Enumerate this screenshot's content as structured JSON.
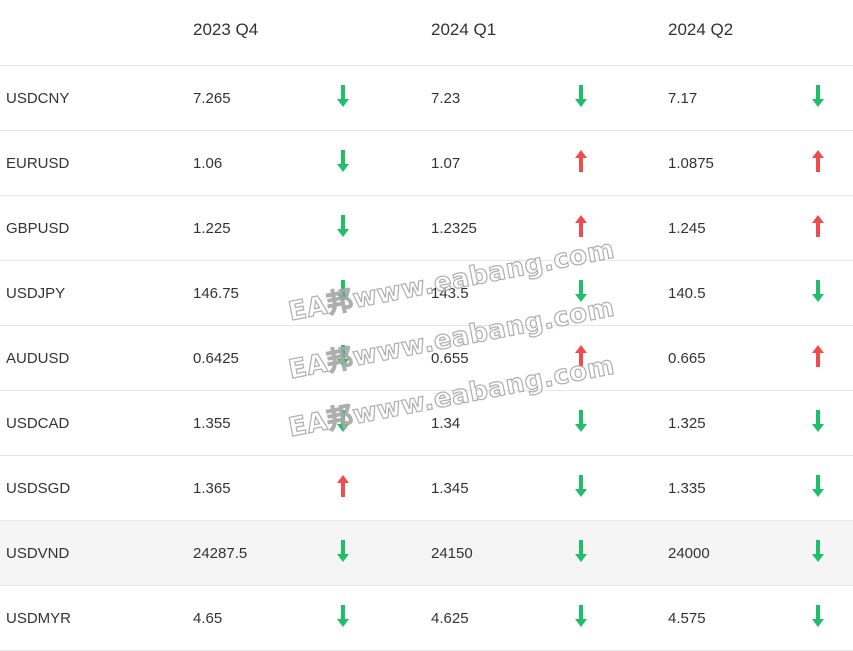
{
  "header": {
    "col1": "2023 Q4",
    "col2": "2024 Q1",
    "col3": "2024 Q2"
  },
  "colors": {
    "down": "#1fbf6a",
    "up": "#ef4d4d"
  },
  "rows": [
    {
      "pair": "USDCNY",
      "v1": "7.265",
      "d1": "down",
      "v2": "7.23",
      "d2": "down",
      "v3": "7.17",
      "d3": "down"
    },
    {
      "pair": "EURUSD",
      "v1": "1.06",
      "d1": "down",
      "v2": "1.07",
      "d2": "up",
      "v3": "1.0875",
      "d3": "up"
    },
    {
      "pair": "GBPUSD",
      "v1": "1.225",
      "d1": "down",
      "v2": "1.2325",
      "d2": "up",
      "v3": "1.245",
      "d3": "up"
    },
    {
      "pair": "USDJPY",
      "v1": "146.75",
      "d1": "down",
      "v2": "143.5",
      "d2": "down",
      "v3": "140.5",
      "d3": "down"
    },
    {
      "pair": "AUDUSD",
      "v1": "0.6425",
      "d1": "down",
      "v2": "0.655",
      "d2": "up",
      "v3": "0.665",
      "d3": "up"
    },
    {
      "pair": "USDCAD",
      "v1": "1.355",
      "d1": "down",
      "v2": "1.34",
      "d2": "down",
      "v3": "1.325",
      "d3": "down"
    },
    {
      "pair": "USDSGD",
      "v1": "1.365",
      "d1": "up",
      "v2": "1.345",
      "d2": "down",
      "v3": "1.335",
      "d3": "down"
    },
    {
      "pair": "USDVND",
      "v1": "24287.5",
      "d1": "down",
      "v2": "24150",
      "d2": "down",
      "v3": "24000",
      "d3": "down"
    },
    {
      "pair": "USDMYR",
      "v1": "4.65",
      "d1": "down",
      "v2": "4.625",
      "d2": "down",
      "v3": "4.575",
      "d3": "down"
    }
  ],
  "watermarks": [
    {
      "text": "EA邦www.eabang.com"
    },
    {
      "text": "EA邦www.eabang.com"
    },
    {
      "text": "EA邦www.eabang.com"
    }
  ]
}
